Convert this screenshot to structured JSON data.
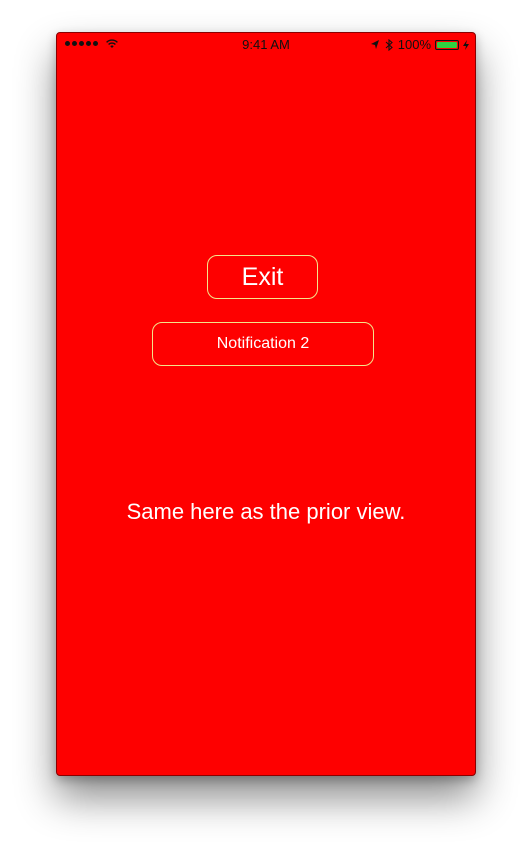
{
  "status_bar": {
    "time": "9:41 AM",
    "battery_percent": "100%",
    "battery_level": 1.0,
    "signal_icon": "cellular-signal-icon",
    "wifi_icon": "wifi-icon",
    "location_icon": "location-arrow-icon",
    "bluetooth_icon": "bluetooth-icon",
    "charging_icon": "charging-bolt-icon"
  },
  "main": {
    "exit_label": "Exit",
    "notification_label": "Notification 2",
    "message": "Same here as the prior view."
  },
  "colors": {
    "background": "#fe0000",
    "button_border": "#f4e58a",
    "text": "#ffffff",
    "battery_fill": "#30d140"
  }
}
